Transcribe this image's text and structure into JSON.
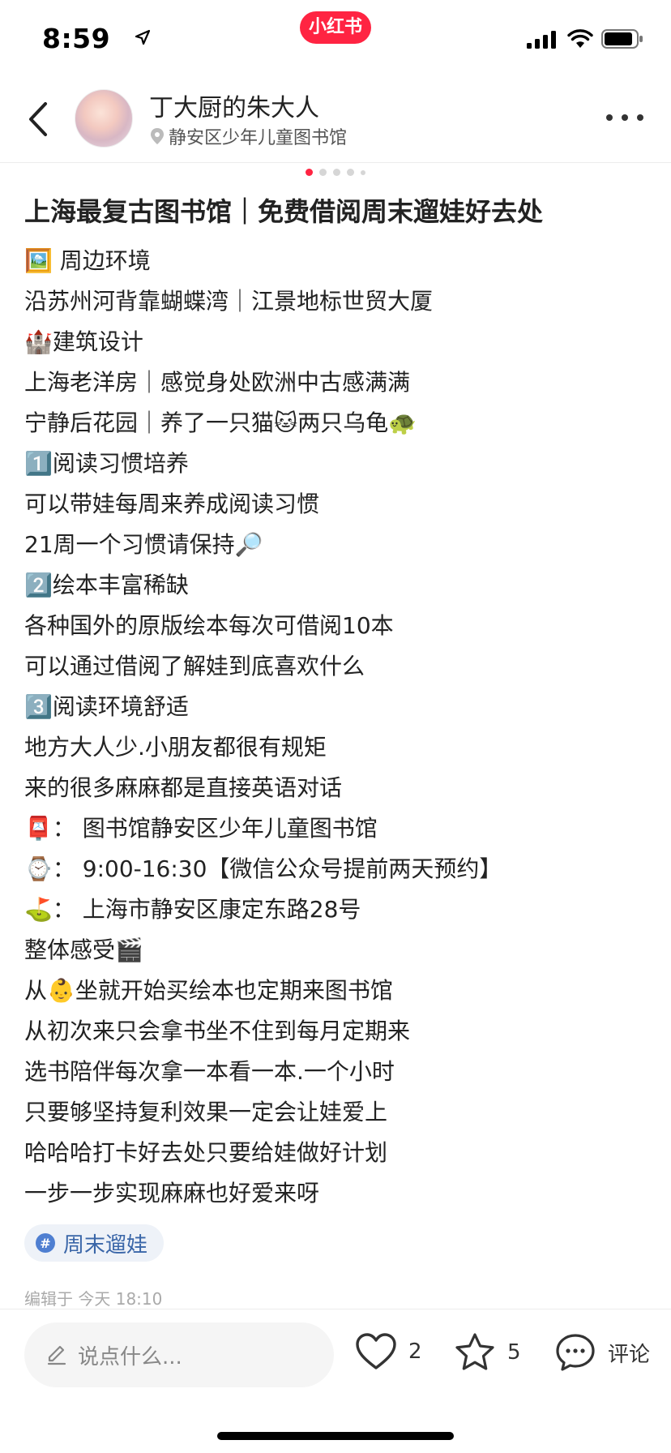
{
  "status_bar": {
    "time": "8:59",
    "app_badge": "小红书"
  },
  "header": {
    "author_name": "丁大厨的朱大人",
    "location": "静安区少年儿童图书馆"
  },
  "post": {
    "title": "上海最复古图书馆｜免费借阅周末遛娃好去处",
    "lines": [
      "🖼️ 周边环境",
      "沿苏州河背靠蝴蝶湾｜江景地标世贸大厦",
      "🏰建筑设计",
      "上海老洋房｜感觉身处欧洲中古感满满",
      "宁静后花园｜养了一只猫🐱两只乌龟🐢",
      "1️⃣阅读习惯培养",
      "可以带娃每周来养成阅读习惯",
      "21周一个习惯请保持🔎",
      "2️⃣绘本丰富稀缺",
      "各种国外的原版绘本每次可借阅10本",
      "可以通过借阅了解娃到底喜欢什么",
      "3️⃣阅读环境舒适",
      "地方大人少.小朋友都很有规矩",
      "来的很多麻麻都是直接英语对话",
      "📮：  图书馆静安区少年儿童图书馆",
      "⌚：  9:00-16:30【微信公众号提前两天预约】",
      "⛳：  上海市静安区康定东路28号",
      "整体感受🎬",
      "从👶坐就开始买绘本也定期来图书馆",
      "从初次来只会拿书坐不住到每月定期来",
      "选书陪伴每次拿一本看一本.一个小时",
      "只要够坚持复利效果一定会让娃爱上",
      "哈哈哈打卡好去处只要给娃做好计划",
      "一步一步实现麻麻也好爱来呀"
    ],
    "tag": "周末遛娃",
    "tag_symbol": "#",
    "edit_time": "编辑于  今天 18:10"
  },
  "bottom_bar": {
    "input_placeholder": "说点什么...",
    "like_count": "2",
    "favorite_count": "5",
    "comment_label": "评论"
  },
  "colors": {
    "brand": "#ff2442",
    "tag_text": "#3a66a8",
    "tag_bg": "#eef2f8"
  }
}
